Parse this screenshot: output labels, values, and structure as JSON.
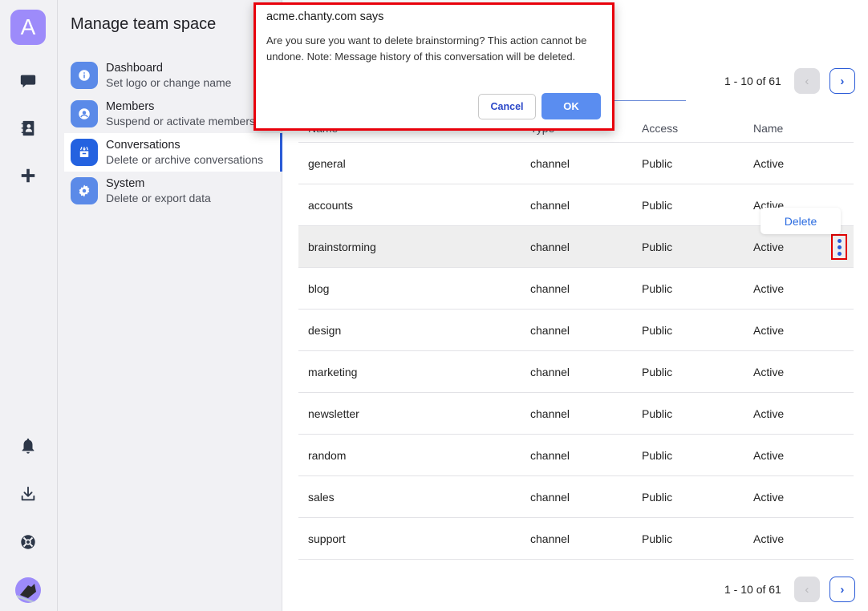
{
  "rail": {
    "logo_letter": "A",
    "icons": [
      "chat-icon",
      "contacts-icon",
      "plus-icon",
      "bell-icon",
      "download-icon",
      "help-lifebuoy-icon",
      "user-avatar"
    ]
  },
  "panel": {
    "title": "Manage team space",
    "items": [
      {
        "icon": "info-icon",
        "title": "Dashboard",
        "subtitle": "Set logo or change name",
        "active": false
      },
      {
        "icon": "member-icon",
        "title": "Members",
        "subtitle": "Suspend or activate members",
        "active": false
      },
      {
        "icon": "archive-icon",
        "title": "Conversations",
        "subtitle": "Delete or archive conversations",
        "active": true
      },
      {
        "icon": "gear-icon",
        "title": "System",
        "subtitle": "Delete or export data",
        "active": false
      }
    ]
  },
  "pagination": {
    "text": "1 - 10 of 61",
    "prev_label": "‹",
    "next_label": "›"
  },
  "table": {
    "headers": [
      "Name",
      "Type",
      "Access",
      "Name"
    ],
    "rows": [
      {
        "name": "general",
        "type": "channel",
        "access": "Public",
        "status": "Active"
      },
      {
        "name": "accounts",
        "type": "channel",
        "access": "Public",
        "status": "Active"
      },
      {
        "name": "brainstorming",
        "type": "channel",
        "access": "Public",
        "status": "Active"
      },
      {
        "name": "blog",
        "type": "channel",
        "access": "Public",
        "status": "Active"
      },
      {
        "name": "design",
        "type": "channel",
        "access": "Public",
        "status": "Active"
      },
      {
        "name": "marketing",
        "type": "channel",
        "access": "Public",
        "status": "Active"
      },
      {
        "name": "newsletter",
        "type": "channel",
        "access": "Public",
        "status": "Active"
      },
      {
        "name": "random",
        "type": "channel",
        "access": "Public",
        "status": "Active"
      },
      {
        "name": "sales",
        "type": "channel",
        "access": "Public",
        "status": "Active"
      },
      {
        "name": "support",
        "type": "channel",
        "access": "Public",
        "status": "Active"
      }
    ]
  },
  "row_menu": {
    "delete_label": "Delete"
  },
  "dialog": {
    "title": "acme.chanty.com says",
    "message": "Are you sure you want to delete brainstorming? This action cannot be undone. Note: Message history of this conversation will be deleted.",
    "cancel_label": "Cancel",
    "ok_label": "OK"
  },
  "colors": {
    "accent": "#2a5bd7",
    "logo": "#9d8bfa",
    "dialog_highlight": "#e8000b"
  }
}
